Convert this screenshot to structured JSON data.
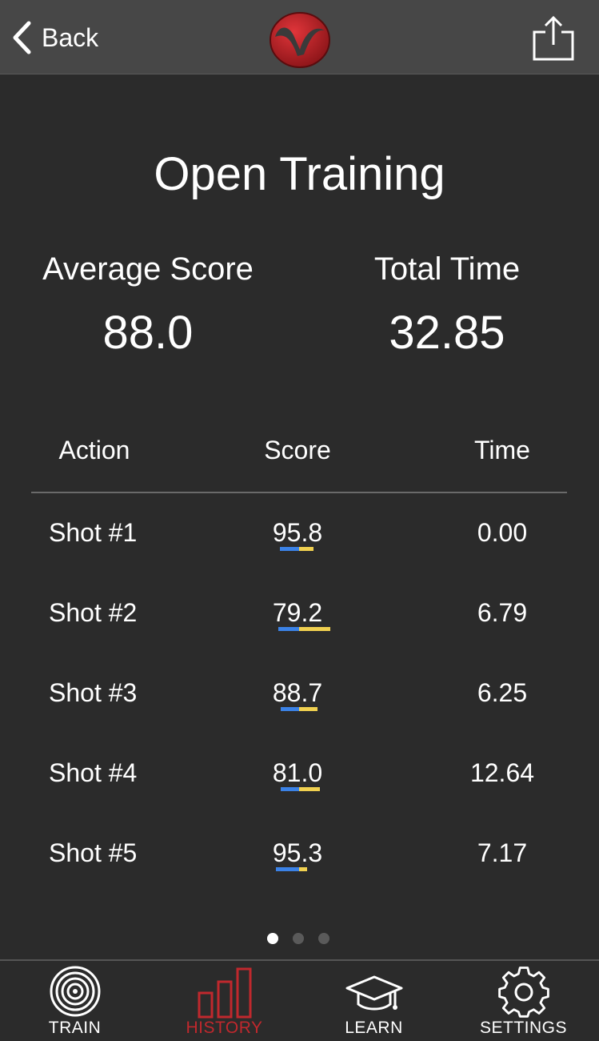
{
  "navbar": {
    "back_label": "Back",
    "logo_icon": "brand-logo-icon",
    "share_icon": "share-icon"
  },
  "title": "Open Training",
  "summary": {
    "average_score_label": "Average Score",
    "average_score_value": "88.0",
    "total_time_label": "Total Time",
    "total_time_value": "32.85"
  },
  "table": {
    "headers": [
      "Action",
      "Score",
      "Time"
    ],
    "rows": [
      {
        "action": "Shot #1",
        "score": "95.8",
        "time": "0.00"
      },
      {
        "action": "Shot #2",
        "score": "79.2",
        "time": "6.79"
      },
      {
        "action": "Shot #3",
        "score": "88.7",
        "time": "6.25"
      },
      {
        "action": "Shot #4",
        "score": "81.0",
        "time": "12.64"
      },
      {
        "action": "Shot #5",
        "score": "95.3",
        "time": "7.17"
      }
    ]
  },
  "pager": {
    "pages": 3,
    "current": 1
  },
  "tabs": [
    {
      "label": "TRAIN",
      "icon": "target-icon",
      "active": false
    },
    {
      "label": "HISTORY",
      "icon": "bar-chart-icon",
      "active": true
    },
    {
      "label": "LEARN",
      "icon": "graduation-cap-icon",
      "active": false
    },
    {
      "label": "SETTINGS",
      "icon": "gear-icon",
      "active": false
    }
  ],
  "colors": {
    "accent": "#c0282d",
    "bar_blue": "#3b82e6",
    "bar_yellow": "#f0d050",
    "background": "#2b2b2b",
    "navbar": "#474747"
  }
}
